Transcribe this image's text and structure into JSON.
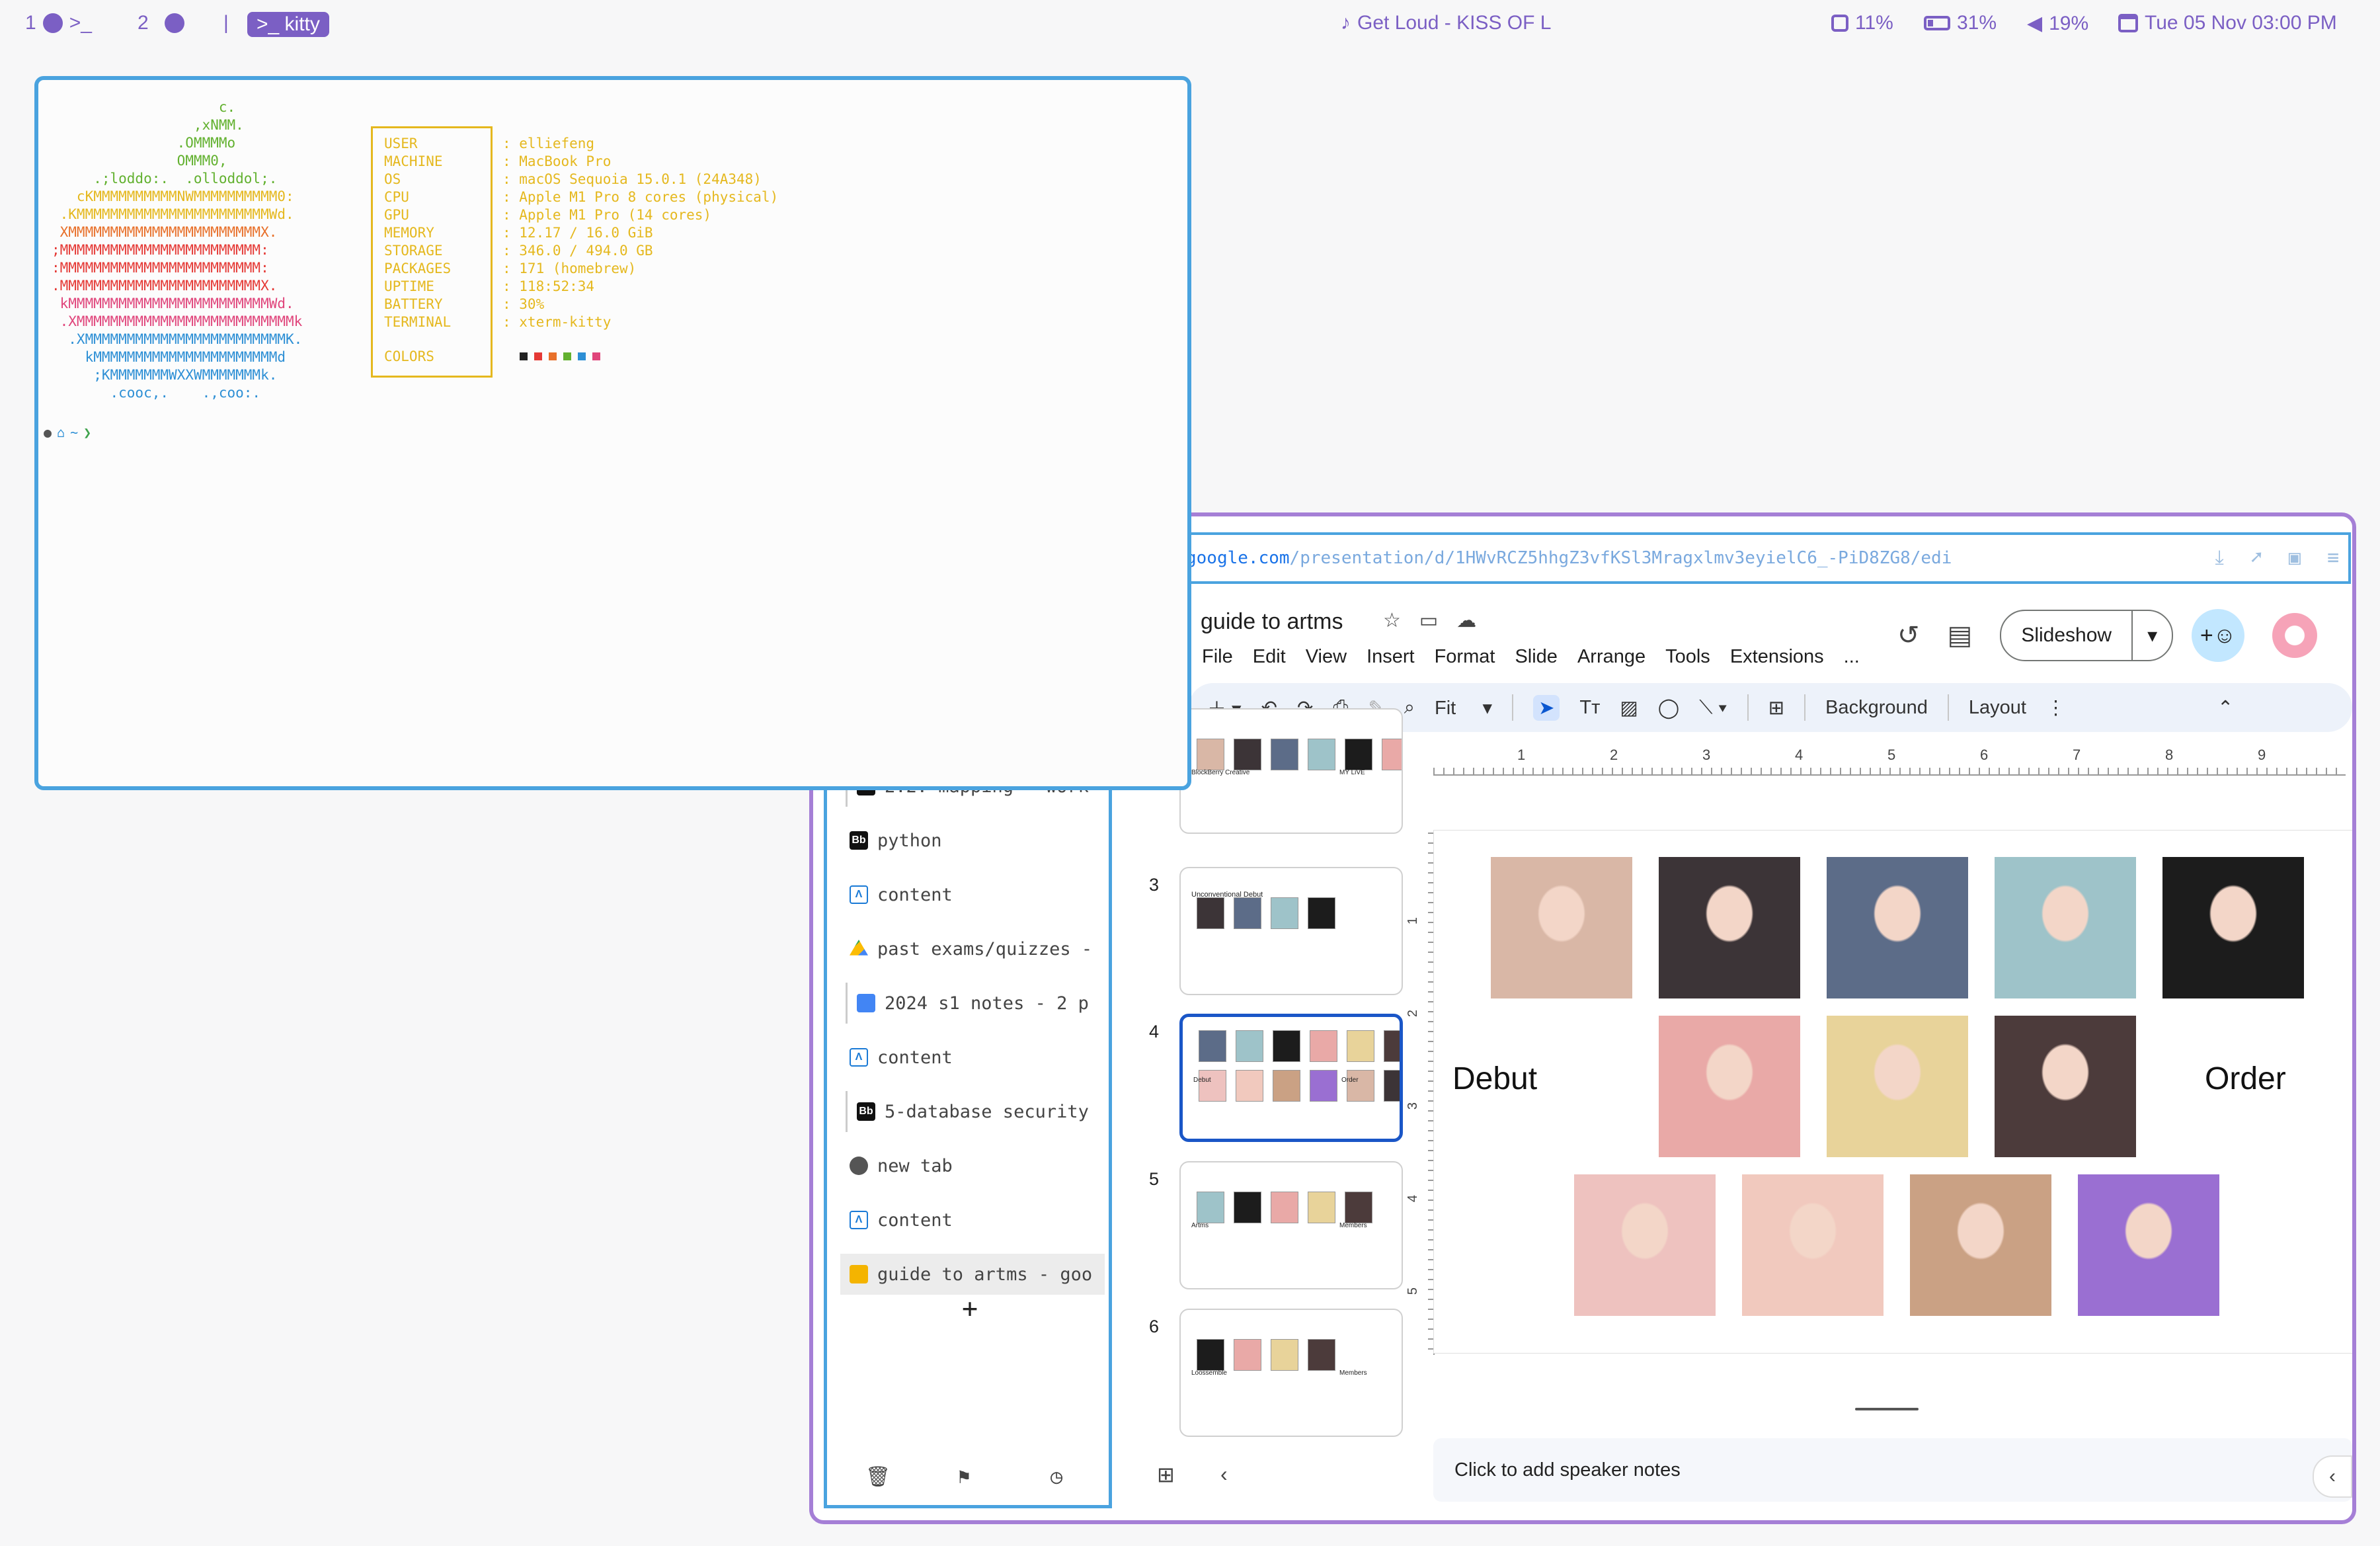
{
  "topbar": {
    "ws1": "1",
    "ws2": "2",
    "sep": "|",
    "kitty": "kitty",
    "music": "Get Loud - KISS OF L",
    "cpu": "11%",
    "battery": "31%",
    "volume": "19%",
    "datetime": "Tue 05 Nov 03:00 PM",
    "icons": [
      "music-note-icon",
      "cpu-icon",
      "battery-icon",
      "volume-icon",
      "calendar-icon"
    ]
  },
  "terminal": {
    "logo_lines": [
      {
        "text": "                    c.",
        "color": "#62b12f"
      },
      {
        "text": "                 ,xNMM.",
        "color": "#62b12f"
      },
      {
        "text": "               .OMMMMo",
        "color": "#62b12f"
      },
      {
        "text": "               OMMM0,",
        "color": "#62b12f"
      },
      {
        "text": "     .;loddo:.  .olloddol;.",
        "color": "#62b12f"
      },
      {
        "text": "   cKMMMMMMMMMMNWMMMMMMMMMM0:",
        "color": "#e5b81e"
      },
      {
        "text": " .KMMMMMMMMMMMMMMMMMMMMMMMWd.",
        "color": "#e5b81e"
      },
      {
        "text": " XMMMMMMMMMMMMMMMMMMMMMMMX.",
        "color": "#e8702a"
      },
      {
        "text": ";MMMMMMMMMMMMMMMMMMMMMMMM:",
        "color": "#e53935"
      },
      {
        "text": ":MMMMMMMMMMMMMMMMMMMMMMMM:",
        "color": "#e53935"
      },
      {
        "text": ".MMMMMMMMMMMMMMMMMMMMMMMMX.",
        "color": "#e53935"
      },
      {
        "text": " kMMMMMMMMMMMMMMMMMMMMMMMMWd.",
        "color": "#e0457b"
      },
      {
        "text": " .XMMMMMMMMMMMMMMMMMMMMMMMMMMk",
        "color": "#e0457b"
      },
      {
        "text": "  .XMMMMMMMMMMMMMMMMMMMMMMMMK.",
        "color": "#2d8fd5"
      },
      {
        "text": "    kMMMMMMMMMMMMMMMMMMMMMMd",
        "color": "#2d8fd5"
      },
      {
        "text": "     ;KMMMMMMMWXXWMMMMMMMk.",
        "color": "#2d8fd5"
      },
      {
        "text": "       .cooc,.    .,coo:.",
        "color": "#2d8fd5"
      }
    ],
    "info": [
      {
        "key": "USER",
        "value": ": elliefeng"
      },
      {
        "key": "MACHINE",
        "value": ": MacBook Pro"
      },
      {
        "key": "OS",
        "value": ": macOS Sequoia 15.0.1 (24A348)"
      },
      {
        "key": "CPU",
        "value": ": Apple M1 Pro 8 cores (physical)"
      },
      {
        "key": "GPU",
        "value": ": Apple M1 Pro (14 cores)"
      },
      {
        "key": "MEMORY",
        "value": ": 12.17 / 16.0 GiB"
      },
      {
        "key": "STORAGE",
        "value": ": 346.0 / 494.0 GB"
      },
      {
        "key": "PACKAGES",
        "value": ": 171 (homebrew)"
      },
      {
        "key": "UPTIME",
        "value": ": 118:52:34"
      },
      {
        "key": "BATTERY",
        "value": ": 30%"
      },
      {
        "key": "TERMINAL",
        "value": ": xterm-kitty"
      }
    ],
    "colors_key": "COLORS",
    "swatches": [
      "#222222",
      "#e53935",
      "#e8702a",
      "#62b12f",
      "#2d8fd5",
      "#e0457b"
    ],
    "prompt_path": "~",
    "prompt_char": "❯"
  },
  "browser": {
    "url_host": "google.com",
    "url_path": "/presentation/d/1HWvRCZ5hhgZ3vfKSl3Mragxlmv3eyielC6_-PiD8ZG8/edi",
    "tabs": [
      {
        "icon": "bb",
        "label": "2.2. mapping - work"
      },
      {
        "icon": "bb",
        "label": "python"
      },
      {
        "icon": "canvas",
        "label": "content"
      },
      {
        "icon": "drive",
        "label": "past exams/quizzes -"
      },
      {
        "icon": "docs",
        "label": "2024 s1 notes - 2 p"
      },
      {
        "icon": "canvas",
        "label": "content"
      },
      {
        "icon": "bb",
        "label": "5-database security"
      },
      {
        "icon": "ff",
        "label": "new tab"
      },
      {
        "icon": "canvas",
        "label": "content"
      },
      {
        "icon": "slides",
        "label": "guide to artms - goo"
      }
    ],
    "new_tab": "+"
  },
  "slides": {
    "doc_title": "guide to artms",
    "menu": [
      "File",
      "Edit",
      "View",
      "Insert",
      "Format",
      "Slide",
      "Arrange",
      "Tools",
      "Extensions",
      "..."
    ],
    "slideshow_label": "Slideshow",
    "toolbar": {
      "zoom": "Fit",
      "background": "Background",
      "layout": "Layout"
    },
    "ruler_h": [
      "1",
      "2",
      "3",
      "4",
      "5",
      "6",
      "7",
      "8",
      "9"
    ],
    "ruler_v": [
      "1",
      "2",
      "3",
      "4",
      "5"
    ],
    "filmstrip": [
      {
        "num": "",
        "title": "",
        "labels": [
          "BlockBerry Creative",
          "MY LiVE"
        ]
      },
      {
        "num": "3",
        "title": "Unconventional Debut",
        "labels": []
      },
      {
        "num": "4",
        "title": "",
        "labels": [
          "Debut",
          "Order"
        ]
      },
      {
        "num": "5",
        "title": "",
        "labels": [
          "Artms",
          "Members"
        ]
      },
      {
        "num": "6",
        "title": "",
        "labels": [
          "Loossemble",
          "Members"
        ]
      }
    ],
    "current_slide": {
      "label_left": "Debut",
      "label_right": "Order"
    },
    "notes_placeholder": "Click to add speaker notes",
    "photo_colors": [
      "#d9b7a6",
      "#3c3437",
      "#5c6c88",
      "#9ec3c9",
      "#1c1c1c",
      "#e9a9a7",
      "#e8d39a",
      "#4c3b3b",
      "#eec2bf",
      "#f1c9be",
      "#caa184",
      "#9a6fd2"
    ]
  }
}
